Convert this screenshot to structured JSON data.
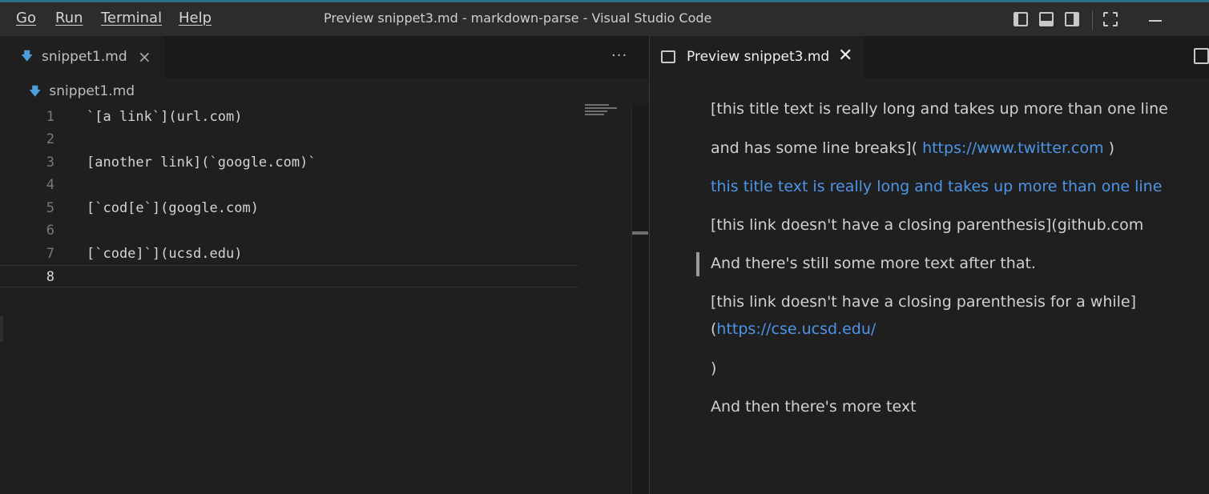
{
  "menu": [
    "Go",
    "Run",
    "Terminal",
    "Help"
  ],
  "window_title": "Preview snippet3.md - markdown-parse - Visual Studio Code",
  "left_tab": {
    "label": "snippet1.md",
    "close": "×",
    "more": "···"
  },
  "breadcrumb": "snippet1.md",
  "code_lines": [
    {
      "num": "1",
      "text": "`[a link`](url.com)"
    },
    {
      "num": "2",
      "text": ""
    },
    {
      "num": "3",
      "text": "[another link](`google.com)`"
    },
    {
      "num": "4",
      "text": ""
    },
    {
      "num": "5",
      "text": "[`cod[e`](google.com)"
    },
    {
      "num": "6",
      "text": ""
    },
    {
      "num": "7",
      "text": "[`code]`](ucsd.edu)"
    },
    {
      "num": "8",
      "text": ""
    }
  ],
  "right_tab": {
    "label": "Preview snippet3.md",
    "close": "✕"
  },
  "preview": {
    "p1_line1": "[this title text is really long and takes up more than one line",
    "p1_line2_pre": "and has some line breaks]( ",
    "p1_link": "https://www.twitter.com",
    "p1_line2_post": " )",
    "p2_link": "this title text is really long and takes up more than one line",
    "p3": "[this link doesn't have a closing parenthesis](github.com",
    "p4": "And there's still some more text after that.",
    "p5_line1": "[this link doesn't have a closing parenthesis for a while]",
    "p5_line2_pre": "(",
    "p5_link": "https://cse.ucsd.edu/",
    "p6": ")",
    "p7": "And then there's more text"
  }
}
